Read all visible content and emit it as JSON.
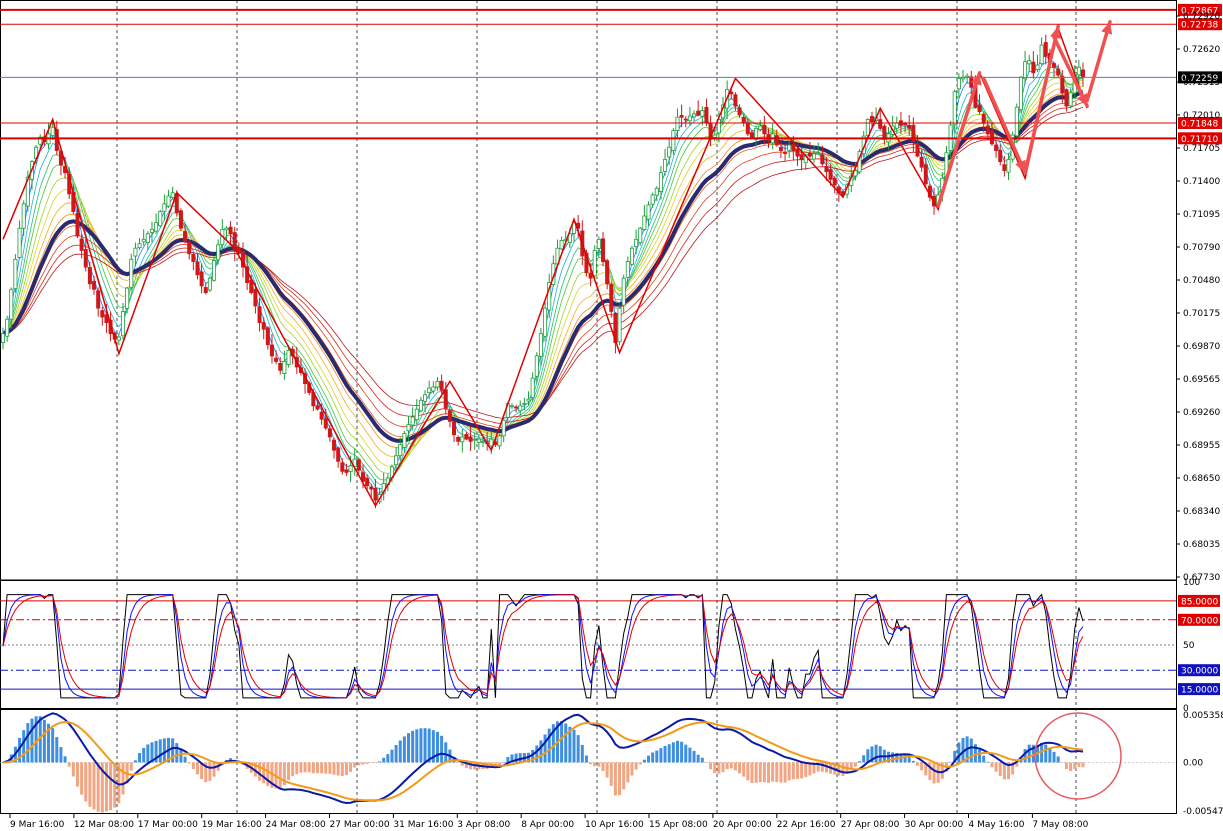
{
  "chart_data": [
    {
      "type": "candlestick",
      "panel": "price",
      "ylim": [
        0.6774,
        0.7292
      ],
      "y_ticks": [
        "0.72920",
        "0.72620",
        "0.72315",
        "0.72010",
        "0.71705",
        "0.71400",
        "0.71095",
        "0.70790",
        "0.70480",
        "0.70175",
        "0.69870",
        "0.69565",
        "0.69260",
        "0.68955",
        "0.68650",
        "0.68340",
        "0.68035",
        "0.67730"
      ],
      "horizontal_levels": [
        {
          "value": 0.72867,
          "label": "0.72867",
          "color": "#e00000",
          "width": 2
        },
        {
          "value": 0.72738,
          "label": "0.72738",
          "color": "#e00000",
          "width": 1
        },
        {
          "value": 0.72259,
          "label": "0.72259",
          "color": "#4a7fd0",
          "width": 1,
          "current": true
        },
        {
          "value": 0.71848,
          "label": "0.71848",
          "color": "#e00000",
          "width": 1
        },
        {
          "value": 0.7171,
          "label": "0.71710",
          "color": "#e00000",
          "width": 2
        }
      ],
      "x_ticks": [
        "9 Mar 16:00",
        "12 Mar 08:00",
        "17 Mar 00:00",
        "19 Mar 16:00",
        "24 Mar 08:00",
        "27 Mar 00:00",
        "31 Mar 16:00",
        "3 Apr 08:00",
        "8 Apr 00:00",
        "10 Apr 16:00",
        "15 Apr 08:00",
        "20 Apr 00:00",
        "22 Apr 16:00",
        "27 Apr 08:00",
        "30 Apr 00:00",
        "4 May 16:00",
        "7 May 08:00"
      ],
      "zigzag_pivots": [
        {
          "i": 0,
          "p": 0.708
        },
        {
          "i": 12,
          "p": 0.7188
        },
        {
          "i": 28,
          "p": 0.6977
        },
        {
          "i": 42,
          "p": 0.7122
        },
        {
          "i": 56,
          "p": 0.7072
        },
        {
          "i": 90,
          "p": 0.684
        },
        {
          "i": 108,
          "p": 0.6952
        },
        {
          "i": 118,
          "p": 0.689
        },
        {
          "i": 138,
          "p": 0.7098
        },
        {
          "i": 149,
          "p": 0.6978
        },
        {
          "i": 177,
          "p": 0.7225
        },
        {
          "i": 203,
          "p": 0.7118
        },
        {
          "i": 212,
          "p": 0.7198
        },
        {
          "i": 226,
          "p": 0.7107
        },
        {
          "i": 236,
          "p": 0.723
        },
        {
          "i": 247,
          "p": 0.7135
        },
        {
          "i": 255,
          "p": 0.727
        },
        {
          "i": 262,
          "p": 0.7198
        }
      ],
      "series": [
        {
          "kind": "candles",
          "close": [
            0.6995,
            0.7008,
            0.7035,
            0.7062,
            0.709,
            0.7112,
            0.7136,
            0.715,
            0.7163,
            0.7172,
            0.7168,
            0.7175,
            0.7181,
            0.716,
            0.7147,
            0.714,
            0.7121,
            0.7105,
            0.7083,
            0.707,
            0.7055,
            0.704,
            0.7035,
            0.7018,
            0.701,
            0.7005,
            0.6995,
            0.699,
            0.6992,
            0.7015,
            0.7036,
            0.7062,
            0.7072,
            0.7076,
            0.708,
            0.7085,
            0.7089,
            0.7095,
            0.7105,
            0.7112,
            0.7119,
            0.7122,
            0.7104,
            0.709,
            0.7078,
            0.7067,
            0.706,
            0.7048,
            0.7038,
            0.7032,
            0.7045,
            0.7061,
            0.7075,
            0.7089,
            0.709,
            0.7085,
            0.707,
            0.7068,
            0.7055,
            0.7041,
            0.7032,
            0.702,
            0.7005,
            0.6999,
            0.6985,
            0.6975,
            0.697,
            0.6962,
            0.697,
            0.698,
            0.6975,
            0.6965,
            0.696,
            0.695,
            0.6942,
            0.693,
            0.6927,
            0.6918,
            0.691,
            0.6902,
            0.689,
            0.688,
            0.6871,
            0.687,
            0.6876,
            0.6882,
            0.6872,
            0.6862,
            0.6858,
            0.6855,
            0.6845,
            0.685,
            0.686,
            0.6865,
            0.6875,
            0.6885,
            0.6895,
            0.6905,
            0.6913,
            0.692,
            0.6927,
            0.6935,
            0.694,
            0.6946,
            0.6947,
            0.6952,
            0.6944,
            0.6928,
            0.6916,
            0.6904,
            0.6898,
            0.6902,
            0.69,
            0.6898,
            0.69,
            0.69,
            0.6898,
            0.6896,
            0.69,
            0.6895,
            0.6903,
            0.6917,
            0.6932,
            0.693,
            0.6928,
            0.693,
            0.6932,
            0.6936,
            0.6955,
            0.6975,
            0.6995,
            0.7018,
            0.7041,
            0.7058,
            0.7072,
            0.7079,
            0.708,
            0.7085,
            0.7095,
            0.709,
            0.7065,
            0.705,
            0.7045,
            0.707,
            0.708,
            0.706,
            0.704,
            0.7015,
            0.6987,
            0.7018,
            0.7045,
            0.706,
            0.7072,
            0.708,
            0.709,
            0.7101,
            0.7111,
            0.712,
            0.7126,
            0.714,
            0.7152,
            0.7163,
            0.7178,
            0.719,
            0.719,
            0.7188,
            0.7191,
            0.7193,
            0.7192,
            0.7196,
            0.7185,
            0.717,
            0.7174,
            0.7188,
            0.7201,
            0.7215,
            0.7211,
            0.72,
            0.7192,
            0.7185,
            0.7175,
            0.7172,
            0.718,
            0.7182,
            0.7175,
            0.7169,
            0.7175,
            0.7165,
            0.716,
            0.7158,
            0.7165,
            0.716,
            0.7155,
            0.7152,
            0.7155,
            0.7155,
            0.7157,
            0.7158,
            0.7148,
            0.7141,
            0.7134,
            0.7129,
            0.7122,
            0.712,
            0.7129,
            0.7137,
            0.7142,
            0.7159,
            0.7173,
            0.7188,
            0.7186,
            0.719,
            0.718,
            0.717,
            0.7175,
            0.7182,
            0.7185,
            0.7183,
            0.7184,
            0.718,
            0.7168,
            0.7155,
            0.7145,
            0.713,
            0.7118,
            0.711,
            0.712,
            0.7135,
            0.7158,
            0.7183,
            0.7213,
            0.7225,
            0.7226,
            0.7227,
            0.7217,
            0.7199,
            0.7195,
            0.7185,
            0.7175,
            0.7166,
            0.716,
            0.715,
            0.7142,
            0.7152,
            0.7174,
            0.7199,
            0.7226,
            0.724,
            0.7241,
            0.723,
            0.7237,
            0.7255,
            0.7245,
            0.724,
            0.7235,
            0.7228,
            0.7212,
            0.72,
            0.7212,
            0.723,
            0.7235,
            0.7226
          ],
          "ema_slow_final": 0.72259
        }
      ]
    },
    {
      "type": "line",
      "panel": "oscillator",
      "ylim": [
        0,
        100
      ],
      "y_ticks": [
        "100",
        "50",
        "0"
      ],
      "levels": [
        {
          "value": 85,
          "label": "85.0000",
          "color": "#e00000",
          "style": "solid"
        },
        {
          "value": 70,
          "label": "70.0000",
          "color": "#e00000",
          "style": "dashdot"
        },
        {
          "value": 50,
          "label": "",
          "color": "#808080",
          "style": "dotted"
        },
        {
          "value": 30,
          "label": "30.0000",
          "color": "#1010c0",
          "style": "dashdot"
        },
        {
          "value": 15,
          "label": "15.0000",
          "color": "#1010c0",
          "style": "solid"
        }
      ],
      "series": [
        {
          "name": "",
          "color": "#000000",
          "role": "fast"
        },
        {
          "name": "",
          "color": "#1010ff",
          "role": "mid"
        },
        {
          "name": "",
          "color": "#e00000",
          "role": "slow"
        }
      ]
    },
    {
      "type": "bar+line",
      "panel": "macd",
      "ylim": [
        -0.0057,
        0.0058
      ],
      "y_ticks": [
        "0.0053585",
        "0.00",
        "-0.005475"
      ],
      "colors": {
        "pos": "#3e8fe0",
        "neg": "#f2a582",
        "main": "#0a1aa8",
        "signal": "#f39a18"
      },
      "annotation": {
        "shape": "circle",
        "color": "#e85a60"
      }
    }
  ],
  "theme": {
    "bull": "#1a9e3b",
    "bear": "#d01818",
    "ema_slow": "#2a2a6e",
    "zigzag": "#e00000",
    "arrow": "#f05050",
    "grid": "#000000"
  }
}
